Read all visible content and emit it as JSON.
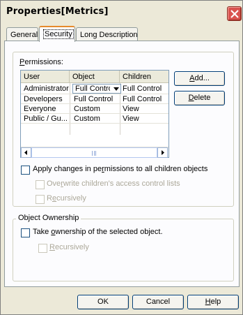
{
  "window": {
    "title": "Properties[Metrics]"
  },
  "tabs": [
    {
      "label": "General"
    },
    {
      "label": "Security"
    },
    {
      "label": "Long Description"
    }
  ],
  "permissions": {
    "label_prefix": "P",
    "label_rest": "ermissions:",
    "columns": [
      "User",
      "Object",
      "Children"
    ],
    "rows": [
      {
        "user": "Administrator",
        "object": "Full Contro",
        "children": "Full Control"
      },
      {
        "user": "Developers",
        "object": "Full Control",
        "children": "Full Control"
      },
      {
        "user": "Everyone",
        "object": "Custom",
        "children": "View"
      },
      {
        "user": "Public / Gu...",
        "object": "Custom",
        "children": "View"
      }
    ],
    "scroll_grip": "|||"
  },
  "buttons": {
    "add": {
      "mnemonic": "A",
      "rest": "dd..."
    },
    "delete": {
      "mnemonic": "D",
      "rest": "elete"
    },
    "ok": "OK",
    "cancel": "Cancel",
    "help": {
      "mnemonic": "H",
      "rest": "elp"
    }
  },
  "options": {
    "apply_changes": {
      "pre": "Apply changes in pe",
      "mnemonic": "r",
      "post": "missions to all children objects",
      "checked": false
    },
    "overwrite_acl": {
      "pre": "Ove",
      "mnemonic": "r",
      "post": "write children's access control lists",
      "checked": false,
      "enabled": false
    },
    "recursively_1": {
      "pre": "R",
      "mnemonic": "e",
      "post": "cursively",
      "checked": false,
      "enabled": false
    }
  },
  "ownership": {
    "legend": "Object Ownership",
    "take_ownership": {
      "pre": "Take ",
      "mnemonic": "o",
      "post": "wnership of the selected object.",
      "checked": false
    },
    "recursively_2": {
      "pre": "",
      "mnemonic": "R",
      "post": "ecursively",
      "checked": false,
      "enabled": false
    }
  },
  "icons": [
    "close-icon",
    "dropdown-arrow-icon",
    "scroll-left-icon",
    "scroll-right-icon"
  ]
}
